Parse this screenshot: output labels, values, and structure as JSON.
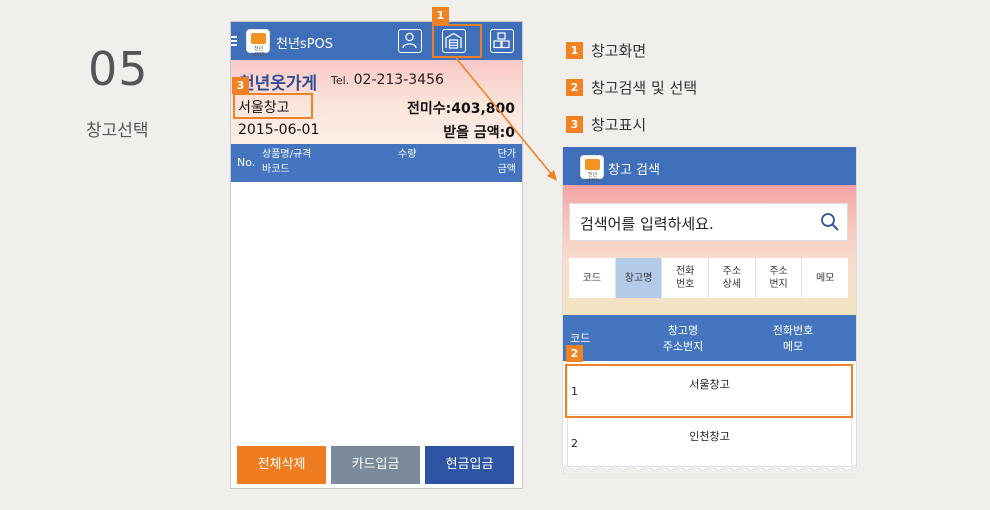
{
  "step": {
    "number": "05",
    "title": "창고선택"
  },
  "phone1": {
    "app_title": "천년sPOS",
    "logo_text": "천년sPOS",
    "icons": [
      "person-icon",
      "warehouse-icon",
      "boxes-icon"
    ],
    "shop_name": "천년옷가게",
    "tel_prefix": "Tel.",
    "tel": "02-213-3456",
    "warehouse": "서울창고",
    "unpaid": "전미수:403,800",
    "date": "2015-06-01",
    "receivable": "받을 금액:0",
    "table": {
      "no": "No.",
      "name_spec": "상품명/규격",
      "barcode": "바코드",
      "qty": "수량",
      "price": "단가",
      "amount": "금액"
    },
    "buttons": {
      "delete_all": "전체삭제",
      "card": "카드입금",
      "cash": "현금입금"
    },
    "colors": {
      "delete": "#f07c22",
      "card": "#7a8a9b",
      "cash": "#2d55a3"
    }
  },
  "legend": [
    {
      "num": "1",
      "text": "창고화면"
    },
    {
      "num": "2",
      "text": "창고검색 및 선택"
    },
    {
      "num": "3",
      "text": "창고표시"
    }
  ],
  "phone2": {
    "title": "창고 검색",
    "logo_text": "천년sPOS",
    "search_placeholder": "검색어를 입력하세요.",
    "tabs": [
      {
        "l1": "코드",
        "l2": ""
      },
      {
        "l1": "창고명",
        "l2": ""
      },
      {
        "l1": "전화",
        "l2": "번호"
      },
      {
        "l1": "주소",
        "l2": "상세"
      },
      {
        "l1": "주소",
        "l2": "번지"
      },
      {
        "l1": "메모",
        "l2": ""
      }
    ],
    "selected_tab": 1,
    "header": {
      "code": "코드",
      "name": "창고명",
      "addr": "주소번지",
      "phone": "전화번호",
      "memo": "메모"
    },
    "rows": [
      {
        "code": "1",
        "name": "서울창고"
      },
      {
        "code": "2",
        "name": "인천창고"
      }
    ]
  },
  "callouts": {
    "c1": "1",
    "c2": "2",
    "c3": "3"
  },
  "accent": "#f08224"
}
